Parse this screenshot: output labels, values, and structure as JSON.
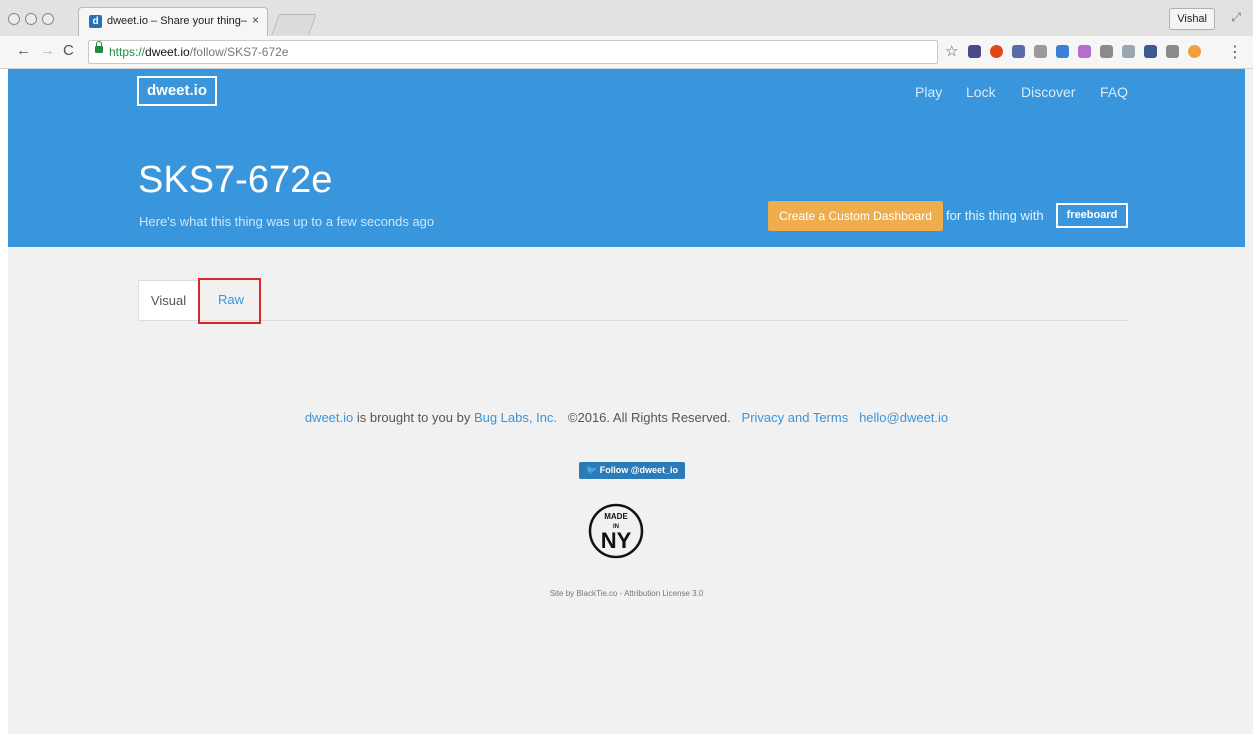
{
  "browser": {
    "tab_title": "dweet.io – Share your thing– ",
    "tab_favicon": "d",
    "tab_close": "×",
    "profile_name": "Vishal",
    "url_scheme": "https://",
    "url_host": "dweet.io",
    "url_path": "/follow/SKS7-672e",
    "icons": [
      "back-icon",
      "forward-icon",
      "reload-icon",
      "lock-icon",
      "star-icon",
      "menu-icon"
    ]
  },
  "header": {
    "logo": "dweet.io",
    "nav": [
      "Play",
      "Lock",
      "Discover",
      "FAQ"
    ],
    "thing_name": "SKS7-672e",
    "subtitle": "Here's what this thing was up to a few seconds ago",
    "dashboard_button": "Create a Custom Dashboard",
    "for_text": "for this thing with",
    "freeboard_button": "freeboard"
  },
  "tabs": {
    "visual": "Visual",
    "raw": "Raw"
  },
  "footer": {
    "brand_link": "dweet.io",
    "brought_by": " is brought to you by ",
    "company_link": "Bug Labs, Inc.",
    "copyright": "©2016. All Rights Reserved.",
    "privacy_link": "Privacy and Terms",
    "email_link": "hello@dweet.io",
    "twitter_button": "Follow @dweet_io",
    "badge_top": "MADE",
    "badge_mid": "IN",
    "badge_bottom": "NY",
    "credit": "Site by BlackTie.co - Attribution License 3.0"
  },
  "colors": {
    "hero": "#3a96dc",
    "accent_button": "#f0ad4e",
    "highlight": "#d9262c"
  }
}
